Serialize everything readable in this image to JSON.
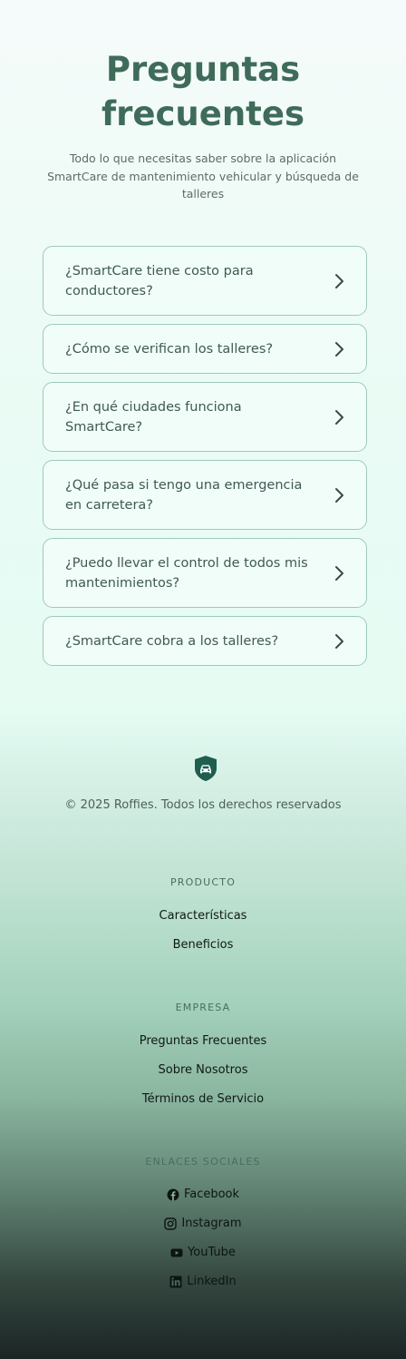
{
  "faq": {
    "title_line1": "Preguntas",
    "title_line2": "frecuentes",
    "subtitle": "Todo lo que necesitas saber sobre la aplicación SmartCare de mantenimiento vehicular y búsqueda de talleres",
    "items": [
      {
        "question": "¿SmartCare tiene costo para conductores?"
      },
      {
        "question": "¿Cómo se verifican los talleres?"
      },
      {
        "question": "¿En qué ciudades funciona SmartCare?"
      },
      {
        "question": "¿Qué pasa si tengo una emergencia en carretera?"
      },
      {
        "question": "¿Puedo llevar el control de todos mis mantenimientos?"
      },
      {
        "question": "¿SmartCare cobra a los talleres?"
      }
    ],
    "chevron_icon": "chevron-right-icon"
  },
  "footer": {
    "logo_icon": "shield-car-icon",
    "copyright": "© 2025 Roffies. Todos los derechos reservados",
    "producto": {
      "heading": "PRODUCTO",
      "links": [
        "Características",
        "Beneficios"
      ]
    },
    "empresa": {
      "heading": "EMPRESA",
      "links": [
        "Preguntas Frecuentes",
        "Sobre Nosotros",
        "Términos de Servicio"
      ]
    },
    "social": {
      "heading": "ENLACES SOCIALES",
      "links": [
        {
          "label": "Facebook",
          "icon": "facebook-icon"
        },
        {
          "label": "Instagram",
          "icon": "instagram-icon"
        },
        {
          "label": "YouTube",
          "icon": "youtube-icon"
        },
        {
          "label": "LinkedIn",
          "icon": "linkedin-icon"
        }
      ]
    }
  },
  "colors": {
    "accent": "#3f6b5a",
    "card_border": "#9fcabb",
    "logo": "#1f5e4f"
  }
}
